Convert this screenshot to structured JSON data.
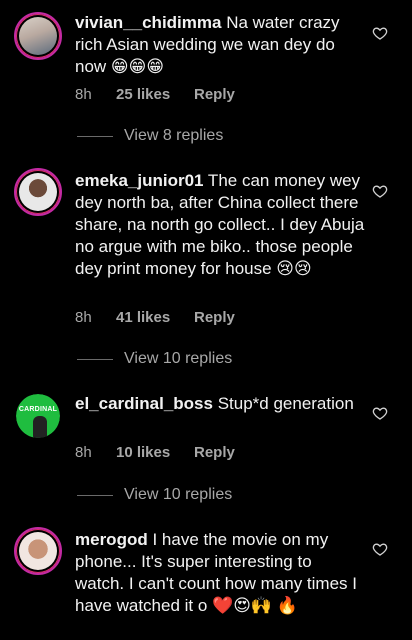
{
  "comments": [
    {
      "username": "vivian__chidimma",
      "text": " Na water crazy rich Asian wedding we wan dey do now 😁😁😁",
      "time": "8h",
      "likes": "25 likes",
      "reply": "Reply",
      "view_replies": "View 8 replies"
    },
    {
      "username": "emeka_junior01",
      "text": " The can money wey dey north ba, after China collect there share, na north go collect.. I dey Abuja no argue with me biko.. those people dey print money for house 😢😢",
      "time": "8h",
      "likes": "41 likes",
      "reply": "Reply",
      "view_replies": "View 10 replies"
    },
    {
      "username": "el_cardinal_boss",
      "text": " Stup*d generation",
      "time": "8h",
      "likes": "10 likes",
      "reply": "Reply",
      "view_replies": "View 10 replies",
      "avatar_text": "CARDINAL"
    },
    {
      "username": "merogod",
      "text": " I have the movie on my phone... It's super interesting to watch. I can't count how many times I have watched it o ❤️😍🙌 🔥"
    }
  ],
  "colors": {
    "background": "#000000",
    "text": "#f2f2f2",
    "muted": "#a8a8a8",
    "story_ring": "#c32aa3",
    "avatar_green": "#1fbd3f"
  },
  "icons": {
    "like": "heart-outline-icon"
  }
}
